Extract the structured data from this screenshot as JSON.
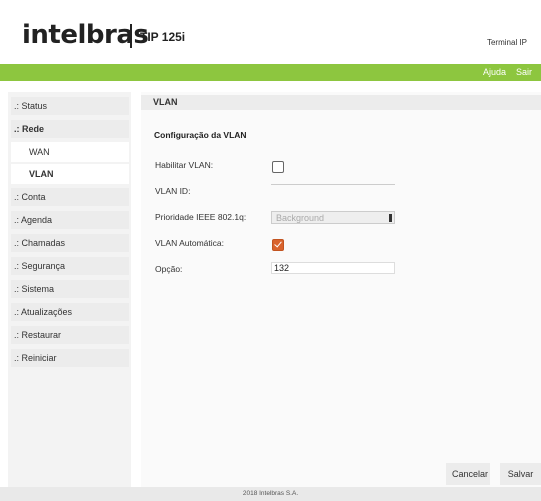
{
  "header": {
    "logo_text": "intelbras",
    "product": "TIP 125i",
    "subtitle": "Terminal IP",
    "links": {
      "help": "Ajuda",
      "logout": "Sair"
    },
    "accent_color": "#8dc63f"
  },
  "sidebar": {
    "items": [
      {
        "label": ".: Status"
      },
      {
        "label": ".: Rede"
      },
      {
        "label": "WAN"
      },
      {
        "label": "VLAN"
      },
      {
        "label": ".: Conta"
      },
      {
        "label": ".: Agenda"
      },
      {
        "label": ".: Chamadas"
      },
      {
        "label": ".: Segurança"
      },
      {
        "label": ".: Sistema"
      },
      {
        "label": ".: Atualizações"
      },
      {
        "label": ".: Restaurar"
      },
      {
        "label": ".: Reiniciar"
      }
    ],
    "active_item": "VLAN"
  },
  "main": {
    "title": "VLAN",
    "section_title": "Configuração da VLAN",
    "fields": {
      "enable_vlan": {
        "label": "Habilitar VLAN:",
        "checked": false
      },
      "vlan_id": {
        "label": "VLAN ID:",
        "value": ""
      },
      "priority": {
        "label": "Prioridade IEEE 802.1q:",
        "value": "Background"
      },
      "auto_vlan": {
        "label": "VLAN Automática:",
        "checked": true
      },
      "option": {
        "label": "Opção:",
        "value": "132"
      }
    },
    "buttons": {
      "cancel": "Cancelar",
      "save": "Salvar"
    },
    "checkbox_color": "#d9632d"
  },
  "footer": {
    "text": "2018 Intelbras S.A."
  }
}
